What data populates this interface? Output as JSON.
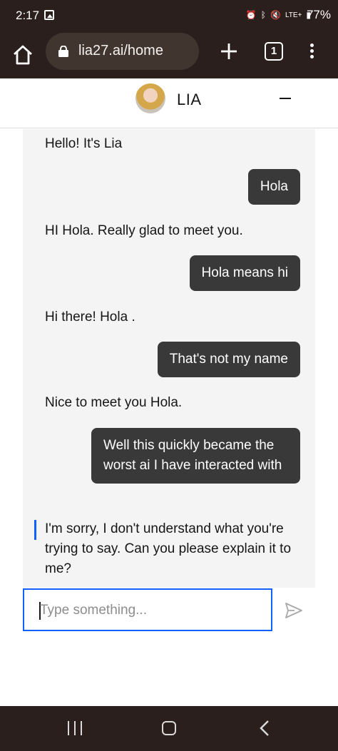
{
  "status_bar": {
    "time": "2:17",
    "network": "LTE+",
    "battery": "77%"
  },
  "browser": {
    "url": "lia27.ai/home",
    "tab_count": "1"
  },
  "chat": {
    "title": "LIA",
    "messages": [
      {
        "sender": "bot",
        "text": "Hello! It's Lia"
      },
      {
        "sender": "user",
        "text": "Hola"
      },
      {
        "sender": "bot",
        "text": "HI Hola. Really glad to meet you."
      },
      {
        "sender": "user",
        "text": "Hola means hi"
      },
      {
        "sender": "bot",
        "text": "Hi there! Hola ."
      },
      {
        "sender": "user",
        "text": "That's not my name"
      },
      {
        "sender": "bot",
        "text": "Nice to meet you Hola."
      },
      {
        "sender": "user",
        "text": "Well this quickly became the worst ai I have interacted with"
      },
      {
        "sender": "bot",
        "text": "I'm sorry, I don't understand what you're trying to say. Can you please explain it to me?"
      }
    ],
    "input_placeholder": "Type something..."
  },
  "colors": {
    "system_bar": "#2a1f1c",
    "user_bubble": "#393939",
    "chat_background": "#f4f4f4",
    "focus_accent": "#0f62fe"
  }
}
